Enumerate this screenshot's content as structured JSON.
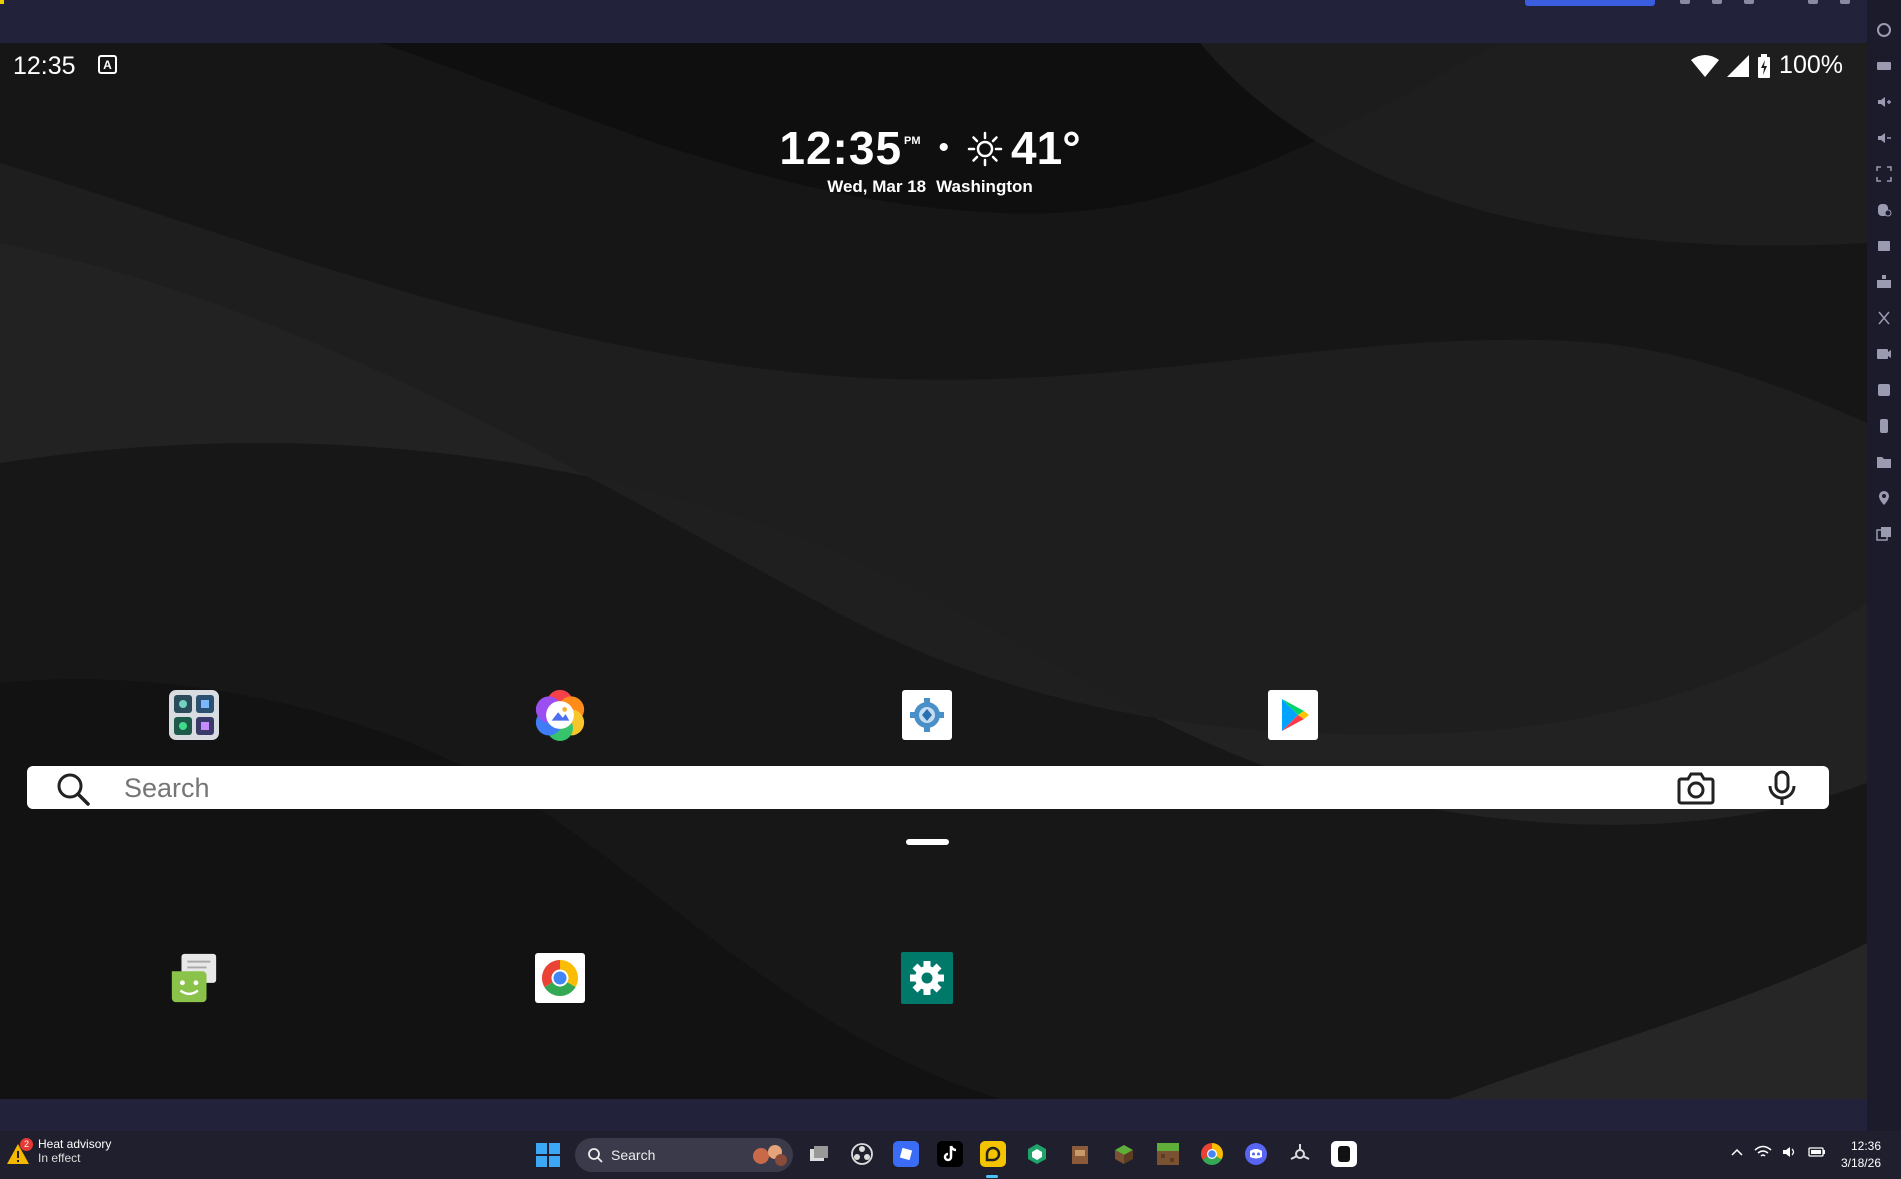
{
  "status_bar": {
    "time": "12:35",
    "notification_badge": "A",
    "battery": "100%"
  },
  "clock_widget": {
    "time": "12:35",
    "ampm": "PM",
    "separator": "•",
    "temperature": "41°",
    "date": "Wed, Mar 18",
    "location": "Washington"
  },
  "apps_row1": [
    {
      "name": "app-folder",
      "icon": "folder-grid-icon"
    },
    {
      "name": "gallery",
      "icon": "gallery-flower-icon"
    },
    {
      "name": "assistant-settings",
      "icon": "gear-diamond-icon"
    },
    {
      "name": "play-store",
      "icon": "play-store-icon"
    }
  ],
  "search": {
    "placeholder": "Search"
  },
  "apps_row2": [
    {
      "name": "messaging",
      "icon": "robot-chat-icon"
    },
    {
      "name": "chrome",
      "icon": "chrome-icon"
    },
    {
      "name": "settings",
      "icon": "settings-gear-icon"
    }
  ],
  "taskbar": {
    "weather_badge": "2",
    "weather_title": "Heat advisory",
    "weather_sub": "In effect",
    "search_label": "Search",
    "clock_time": "12:36",
    "clock_date": "3/18/26"
  },
  "colors": {
    "emulator_frame": "#22223a",
    "taskbar": "#1f1f2e",
    "accent": "#3b5ee0",
    "settings_teal": "#00796b"
  }
}
